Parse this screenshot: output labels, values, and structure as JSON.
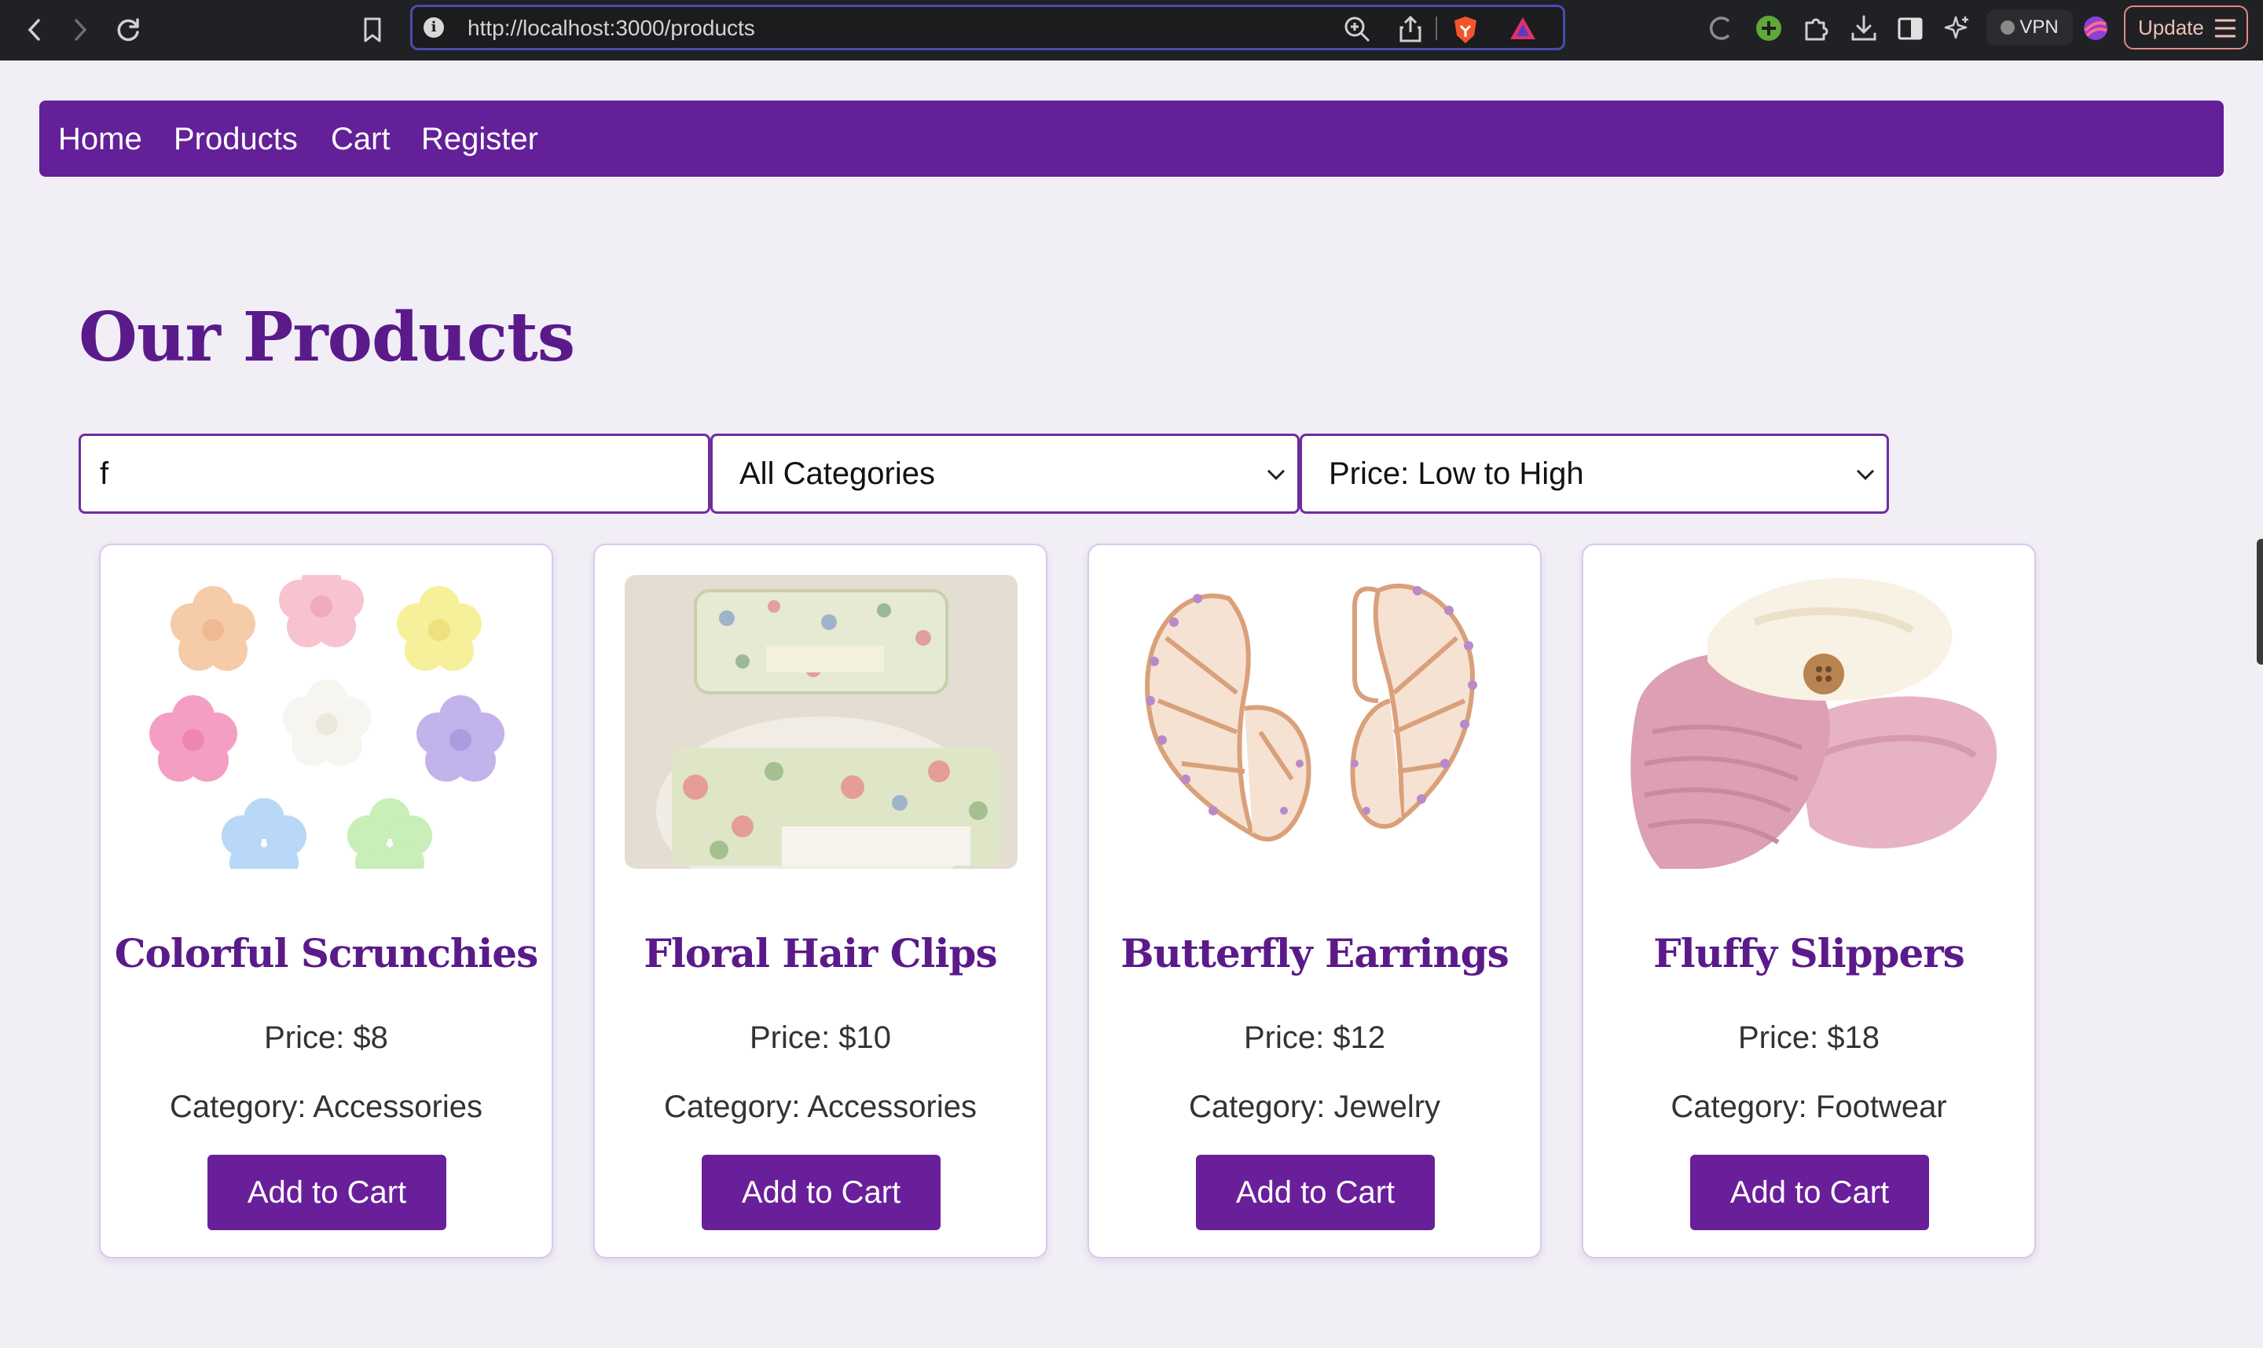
{
  "browser": {
    "url": "http://localhost:3000/products",
    "vpn_label": "VPN",
    "update_label": "Update"
  },
  "nav": {
    "items": [
      {
        "label": "Home"
      },
      {
        "label": "Products"
      },
      {
        "label": "Cart"
      },
      {
        "label": "Register"
      }
    ]
  },
  "page": {
    "title": "Our Products"
  },
  "filters": {
    "search_value": "f",
    "category_selected": "All Categories",
    "sort_selected": "Price: Low to High"
  },
  "products": [
    {
      "name": "Colorful Scrunchies",
      "price_label": "Price: $8",
      "category_label": "Category: Accessories",
      "button": "Add to Cart"
    },
    {
      "name": "Floral Hair Clips",
      "price_label": "Price: $10",
      "category_label": "Category: Accessories",
      "button": "Add to Cart"
    },
    {
      "name": "Butterfly Earrings",
      "price_label": "Price: $12",
      "category_label": "Category: Jewelry",
      "button": "Add to Cart"
    },
    {
      "name": "Fluffy Slippers",
      "price_label": "Price: $18",
      "category_label": "Category: Footwear",
      "button": "Add to Cart"
    }
  ],
  "colors": {
    "brand": "#632098",
    "button": "#6a1f9a",
    "title": "#5b1a8a",
    "background": "#f1eef6"
  }
}
